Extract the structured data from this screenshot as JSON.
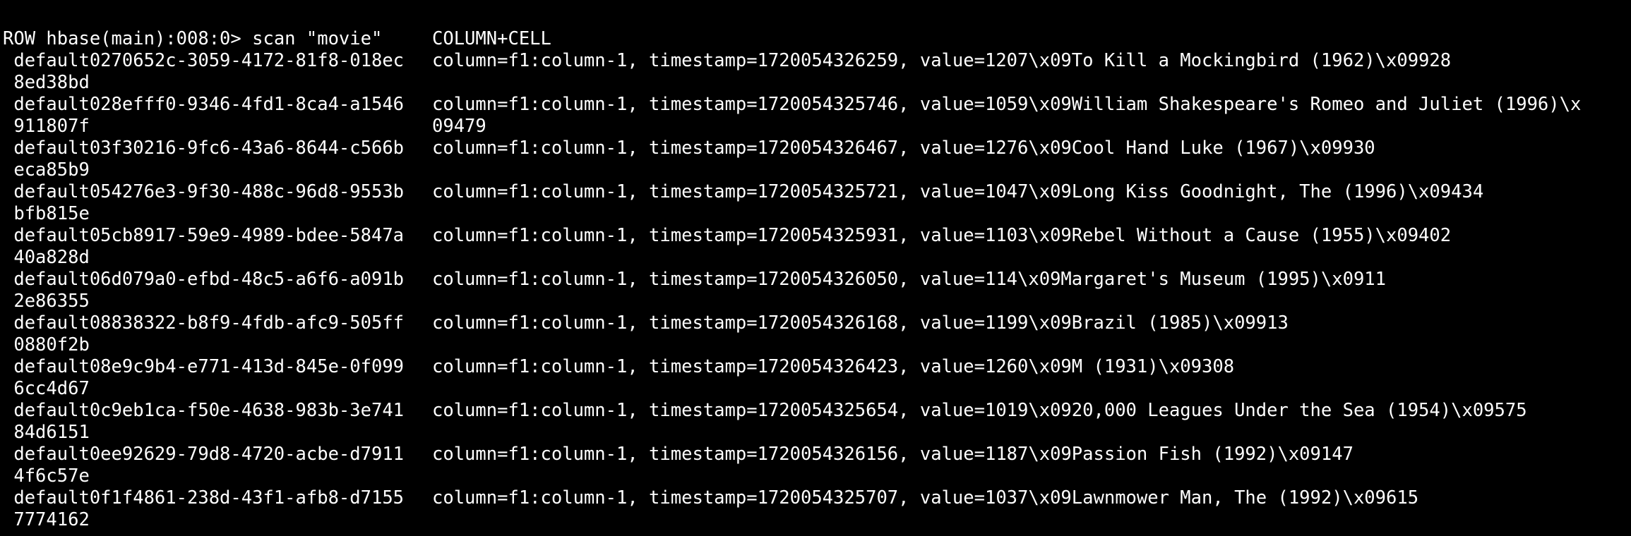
{
  "colors": {
    "background": "#000000",
    "text": "#ffffff"
  },
  "prompt": "hbase(main):008:0> scan \"movie\"",
  "header": {
    "row": "ROW",
    "column_cell": "COLUMN+CELL"
  },
  "rows": [
    {
      "row1": " default0270652c-3059-4172-81f8-018ec",
      "cell1": "column=f1:column-1, timestamp=1720054326259, value=1207\\x09To Kill a Mockingbird (1962)\\x09928",
      "row2": " 8ed38bd",
      "cell2": ""
    },
    {
      "row1": " default028efff0-9346-4fd1-8ca4-a1546",
      "cell1": "column=f1:column-1, timestamp=1720054325746, value=1059\\x09William Shakespeare's Romeo and Juliet (1996)\\x",
      "row2": " 911807f",
      "cell2": "09479"
    },
    {
      "row1": " default03f30216-9fc6-43a6-8644-c566b",
      "cell1": "column=f1:column-1, timestamp=1720054326467, value=1276\\x09Cool Hand Luke (1967)\\x09930",
      "row2": " eca85b9",
      "cell2": ""
    },
    {
      "row1": " default054276e3-9f30-488c-96d8-9553b",
      "cell1": "column=f1:column-1, timestamp=1720054325721, value=1047\\x09Long Kiss Goodnight, The (1996)\\x09434",
      "row2": " bfb815e",
      "cell2": ""
    },
    {
      "row1": " default05cb8917-59e9-4989-bdee-5847a",
      "cell1": "column=f1:column-1, timestamp=1720054325931, value=1103\\x09Rebel Without a Cause (1955)\\x09402",
      "row2": " 40a828d",
      "cell2": ""
    },
    {
      "row1": " default06d079a0-efbd-48c5-a6f6-a091b",
      "cell1": "column=f1:column-1, timestamp=1720054326050, value=114\\x09Margaret's Museum (1995)\\x0911",
      "row2": " 2e86355",
      "cell2": ""
    },
    {
      "row1": " default08838322-b8f9-4fdb-afc9-505ff",
      "cell1": "column=f1:column-1, timestamp=1720054326168, value=1199\\x09Brazil (1985)\\x09913",
      "row2": " 0880f2b",
      "cell2": ""
    },
    {
      "row1": " default08e9c9b4-e771-413d-845e-0f099",
      "cell1": "column=f1:column-1, timestamp=1720054326423, value=1260\\x09M (1931)\\x09308",
      "row2": " 6cc4d67",
      "cell2": ""
    },
    {
      "row1": " default0c9eb1ca-f50e-4638-983b-3e741",
      "cell1": "column=f1:column-1, timestamp=1720054325654, value=1019\\x0920,000 Leagues Under the Sea (1954)\\x09575",
      "row2": " 84d6151",
      "cell2": ""
    },
    {
      "row1": " default0ee92629-79d8-4720-acbe-d7911",
      "cell1": "column=f1:column-1, timestamp=1720054326156, value=1187\\x09Passion Fish (1992)\\x09147",
      "row2": " 4f6c57e",
      "cell2": ""
    },
    {
      "row1": " default0f1f4861-238d-43f1-afb8-d7155",
      "cell1": "column=f1:column-1, timestamp=1720054325707, value=1037\\x09Lawnmower Man, The (1992)\\x09615",
      "row2": " 7774162",
      "cell2": ""
    }
  ]
}
